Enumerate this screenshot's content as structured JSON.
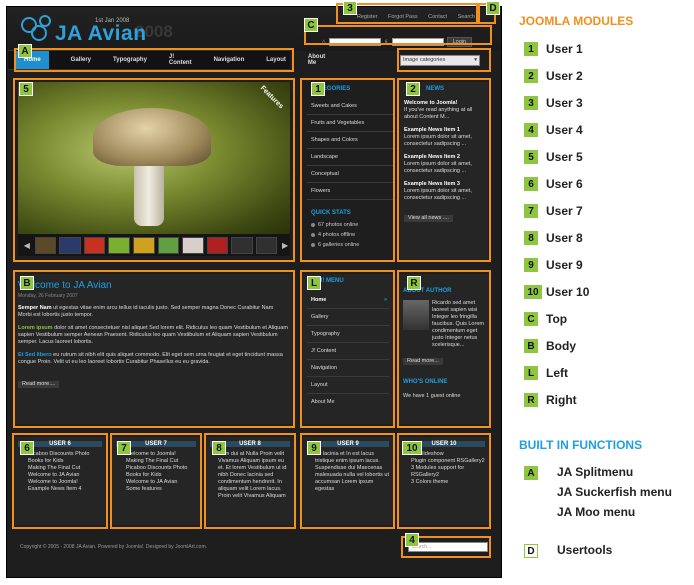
{
  "site": {
    "logo_text": "JA Avian",
    "logo_date": "1st Jan 2008",
    "logo_ghost": "2008",
    "usertools": [
      "Register",
      "Forgot Pass",
      "Contact",
      "Search"
    ],
    "login_button": "Login",
    "menu": [
      "Home",
      "Gallery",
      "Typography",
      "J! Content",
      "Navigation",
      "Layout",
      "About Me"
    ],
    "image_select": "Image categories",
    "feature_label": "Features",
    "categories_title": "CATEGORIES",
    "categories": [
      "Sweets and Cakes",
      "Fruits and Vegetables",
      "Shapes and Colors",
      "Landscape",
      "Conceptual",
      "Flowers"
    ],
    "quick_stats_title": "QUICK STATS",
    "quick_stats": [
      "67 photos online",
      "4 photos offline",
      "6 galleries online"
    ],
    "news_title": "NEWS",
    "news": [
      {
        "title": "Welcome to Joomla!",
        "body": "If you've read anything at all about Content M..."
      },
      {
        "title": "Example News Item 1",
        "body": "Lorem ipsum dolor sit amet, consectetur sadipscing ..."
      },
      {
        "title": "Example News Item 2",
        "body": "Lorem ipsum dolor sit amet, consectetur sadipscing ..."
      },
      {
        "title": "Example News Item 3",
        "body": "Lorem ipsum dolor sit amet, consectetur sadipscing ..."
      }
    ],
    "view_all_news": "View all news ....",
    "body_title": "Welcome to JA Avian",
    "body_date": "Monday, 26 February 2007",
    "body_p1_lead": "Semper Nam",
    "body_p1": "ut egestas vitae enim arcu tellus id iaculis justo. Sed semper magna Donec Curabitur Nam Morbi est lobortis justo tempor.",
    "body_p2_lead": "Lorem ipsum",
    "body_p2": "dolor sit amet consectetuer nisl aliquet Sed lorem elit. Ridiculus leo quam Vestibulum et Aliquam sapien Vestibulum semper Aenean Praesent. Ridiculus leo quam Vestibulum et Aliquam sapien Vestibulum semper. Lacus laoreet lobortis.",
    "body_p3_lead": "Et Sed libero",
    "body_p3": "eu rutrum sit nibh elit quis aliquet commodo. Elit eget sem urna feugiat et eget tincidunt massa congue Proin. Velit ut eu leo laoreet lobortis Curabitur Phasellus eu eu gravida.",
    "read_more": "Read more....",
    "left_menu_title": "J! MENU",
    "left_menu": [
      "Home",
      "Gallery",
      "Typography",
      "J! Content",
      "Navigation",
      "Layout",
      "About Me"
    ],
    "about_title": "ABOUT AUTHOR",
    "about_text": "Ricardo sed amet laoreet sapien wisi Integer leo fringilla faucibus. Quis Lorem condimentum eget justo Integer netus scelerisque...",
    "about_read_more": "Read more...",
    "whos_online_title": "WHO'S ONLINE",
    "whos_online": "We have 1 guest online",
    "user6_title": "USER 6",
    "user6": [
      "Picaboo Discounts Photo Books for Kids",
      "Making The Final Cut",
      "Welcome to JA Avian",
      "Welcome to Joomla!",
      "Example News Item 4"
    ],
    "user7_title": "USER 7",
    "user7": [
      "Welcome to Joomla!",
      "Making The Final Cut",
      "Picaboo Discounts Photo Books for Kids",
      "Welcome to JA Avian",
      "Some features"
    ],
    "user8_title": "USER 8",
    "user8": "Sem dui at Nulla Proin velit Vivamus Aliquam ipsum eu et. Et lorem Vestibulum ut id nibh Donec lacinia sed condimentum hendrerit. In aliquam velit Lorem lacus. Proin velit Vivamus Aliquam",
    "user9_title": "USER 9",
    "user9": "Sit lacinia et In est lacus tristique enim ipsum lacus. Suspendisse dui Maecenas malesuada nulla vel lobortis ut accumsan Lorem ipsum egestas",
    "user10_title": "USER 10",
    "user10": [
      "JA Slideshow",
      "Plugin component RSGallery2",
      "3 Modules support for RSGallery2",
      "3 Colors theme"
    ],
    "footer": "Copyright © 2005 - 2008 JA Avian. Powered by Joomla!. Designed by JoomlArt.com.",
    "search_placeholder": "search..."
  },
  "callouts": [
    "1",
    "2",
    "3",
    "4",
    "5",
    "6",
    "7",
    "8",
    "9",
    "10",
    "A",
    "B",
    "C",
    "D",
    "L",
    "R"
  ],
  "legend": {
    "title": "JOOMLA MODULES",
    "items": [
      {
        "badge": "1",
        "label": "User 1"
      },
      {
        "badge": "2",
        "label": "User 2"
      },
      {
        "badge": "3",
        "label": "User 3"
      },
      {
        "badge": "4",
        "label": "User 4"
      },
      {
        "badge": "5",
        "label": "User 5"
      },
      {
        "badge": "6",
        "label": "User 6"
      },
      {
        "badge": "7",
        "label": "User 7"
      },
      {
        "badge": "8",
        "label": "User 8"
      },
      {
        "badge": "9",
        "label": "User 9"
      },
      {
        "badge": "10",
        "label": "User 10"
      },
      {
        "badge": "C",
        "label": "Top"
      },
      {
        "badge": "B",
        "label": "Body"
      },
      {
        "badge": "L",
        "label": "Left"
      },
      {
        "badge": "R",
        "label": "Right"
      }
    ],
    "functions_title": "BUILT IN FUNCTIONS",
    "functions": [
      {
        "badge": "A",
        "labels": [
          "JA Splitmenu",
          "JA Suckerfish menu",
          "JA Moo menu"
        ]
      },
      {
        "badge": "D",
        "labels": [
          "Usertools"
        ]
      }
    ]
  },
  "colors": {
    "accent": "#1f9fe0",
    "callout": "#f0901e",
    "badge": "#8ec641"
  }
}
